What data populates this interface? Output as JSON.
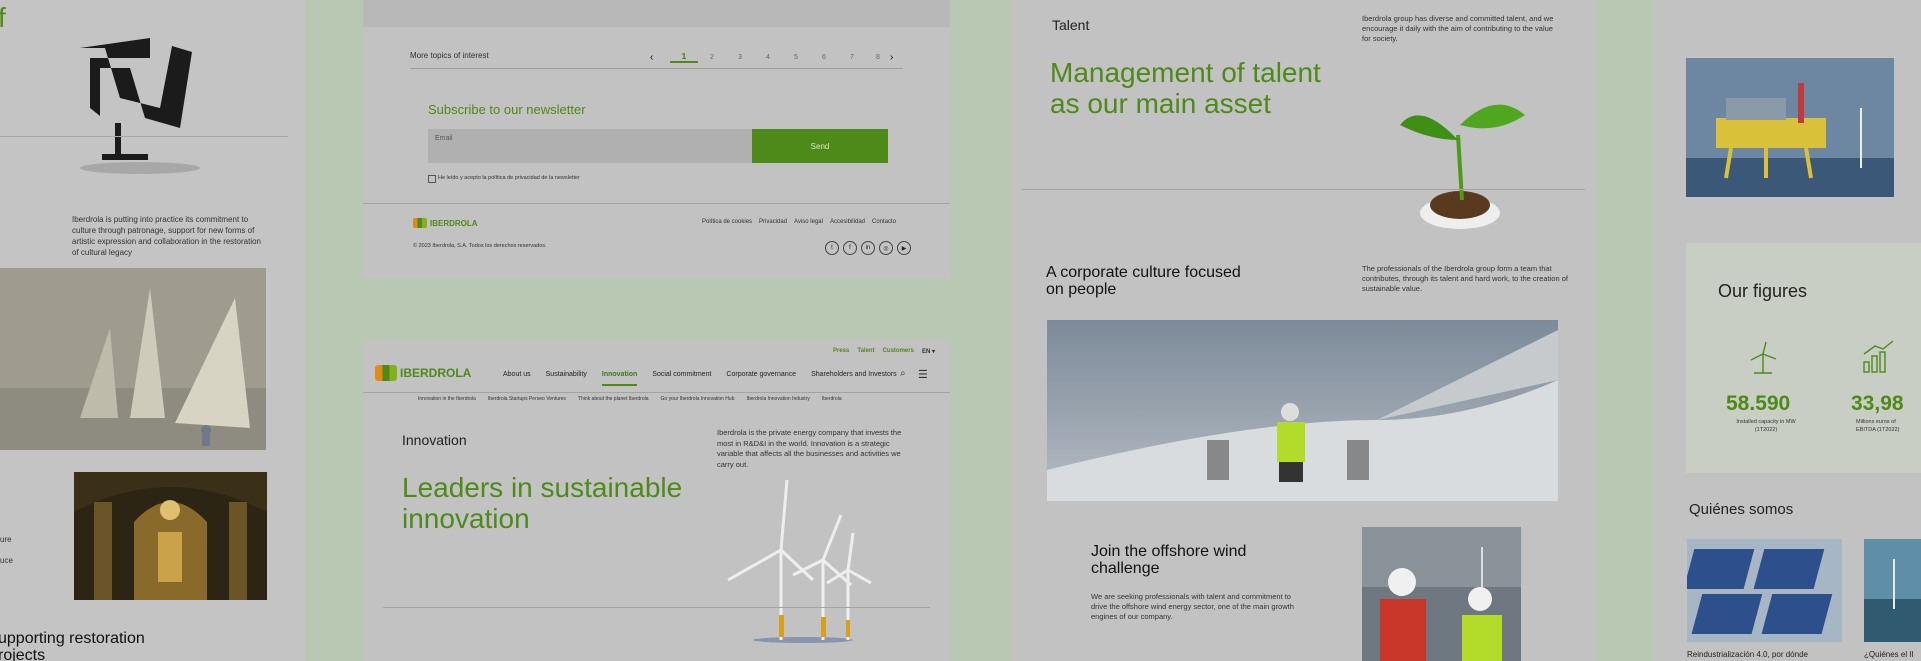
{
  "colors": {
    "background": "#b9c8b3",
    "panel": "#c2c2c2",
    "accent": "#4e8a1a",
    "dark": "#111111"
  },
  "col1": {
    "top_letter": "f",
    "caption": "Iberdrola is putting into practice its commitment to culture through patronage, support for new forms of artistic expression and collaboration in the restoration of cultural legacy",
    "side_a": "ure",
    "side_b": "uce",
    "bottom_title_1": "upporting restoration",
    "bottom_title_2": "rojects"
  },
  "col2": {
    "topics_label": "More topics of interest",
    "pages": [
      "1",
      "2",
      "3",
      "4",
      "5",
      "6",
      "7",
      "8"
    ],
    "active_page": "1",
    "newsletter_title": "Subscribe to our newsletter",
    "email_placeholder": "Email",
    "send_label": "Send",
    "consent_text": "He leído y acepto la política de privacidad de la newsletter",
    "logo_text": "IBERDROLA",
    "footer_links": [
      "Política de cookies",
      "Privacidad",
      "Aviso legal",
      "Accesibilidad",
      "Contacto"
    ],
    "copyright": "© 2023 Iberdrola, S.A. Todos los derechos reservados.",
    "social_icons": [
      "twitter-icon",
      "facebook-icon",
      "linkedin-icon",
      "instagram-icon",
      "youtube-icon"
    ],
    "utility_links": [
      "Press",
      "Talent",
      "Customers"
    ],
    "language": "EN",
    "nav_items": [
      "About us",
      "Sustainability",
      "Innovation",
      "Social commitment",
      "Corporate governance",
      "Shareholders and Investors"
    ],
    "active_nav": "Innovation",
    "subnav_items": [
      "Innovation in the Iberdrola",
      "Iberdrola Startups Perseo Ventures",
      "Think about the planet Iberdrola",
      "Go your Iberdrola Innovation Hub",
      "Iberdrola Innovation Industry",
      "Iberdrola"
    ],
    "section_label": "Innovation",
    "headline_1": "Leaders in sustainable",
    "headline_2": "innovation",
    "intro": "Iberdrola is the private energy company that invests the most in R&D&I in the world. Innovation is a strategic variable that affects all the businesses and activities we carry out."
  },
  "col3": {
    "section_label": "Talent",
    "headline_1": "Management of talent",
    "headline_2": "as our main asset",
    "intro": "Iberdrola group has diverse and committed talent, and we encourage it daily with the aim of contributing to the value for society.",
    "culture_title_1": "A corporate culture focused",
    "culture_title_2": "on people",
    "culture_text": "The professionals of the Iberdrola group form a team that contributes, through its talent and hard work, to the creation of sustainable value.",
    "offshore_title_1": "Join the offshore wind",
    "offshore_title_2": "challenge",
    "offshore_text": "We are seeking professionals with talent and commitment to drive the offshore wind energy sector, one of the main growth engines of our company."
  },
  "col4": {
    "figures_title": "Our figures",
    "figure_1_value": "58.590",
    "figure_1_label": "Installed capacity in MW (1T2022)",
    "figure_2_value": "33,98",
    "figure_2_label": "Millions euros of EBITDA (1T2022)",
    "quienes_title": "Quiénes somos",
    "card_1_caption": "Reindustrialización 4.0, por dónde",
    "card_2_caption": "¿Quiénes el Il"
  }
}
